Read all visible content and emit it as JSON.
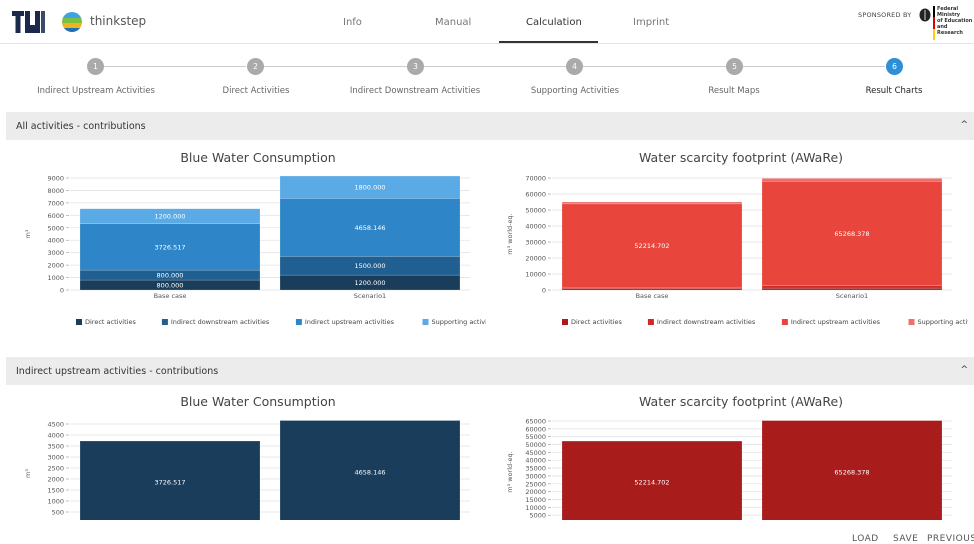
{
  "header": {
    "brand": "thinkstep",
    "tabs": [
      {
        "label": "Info"
      },
      {
        "label": "Manual"
      },
      {
        "label": "Calculation"
      },
      {
        "label": "Imprint"
      }
    ],
    "sponsored_by": "SPONSORED BY",
    "ministry_line1": "Federal Ministry",
    "ministry_line2": "of Education",
    "ministry_line3": "and Research"
  },
  "stepper": {
    "steps": [
      {
        "number": "1",
        "label": "Indirect Upstream Activities"
      },
      {
        "number": "2",
        "label": "Direct Activities"
      },
      {
        "number": "3",
        "label": "Indirect Downstream Activities"
      },
      {
        "number": "4",
        "label": "Supporting Activities"
      },
      {
        "number": "5",
        "label": "Result Maps"
      },
      {
        "number": "6",
        "label": "Result Charts"
      }
    ],
    "active_index": 5
  },
  "sections": [
    {
      "title": "All activities - contributions"
    },
    {
      "title": "Indirect upstream activities - contributions"
    }
  ],
  "colors": {
    "blue_direct": "#1a3d5c",
    "blue_downstream": "#1f5f91",
    "blue_upstream": "#2e86c8",
    "blue_supporting": "#5aaae6",
    "red_direct": "#a81c1c",
    "red_downstream": "#cf2a2a",
    "red_upstream": "#e8453c",
    "red_supporting": "#ef6f6f",
    "accent": "#2e8fd9"
  },
  "chart_data": [
    {
      "type": "bar",
      "stacked": true,
      "title": "Blue Water Consumption",
      "ylabel": "m³",
      "categories": [
        "Base case",
        "Scenario1"
      ],
      "ylim": [
        0,
        9000
      ],
      "yticks": [
        "9000",
        "8000",
        "7000",
        "6000",
        "5000",
        "4000",
        "3000",
        "2000",
        "1000",
        "0"
      ],
      "series": [
        {
          "name": "Direct activities",
          "values": [
            800,
            1200
          ],
          "labels": [
            "800.000",
            "1200.000"
          ]
        },
        {
          "name": "Indirect downstream activities",
          "values": [
            800,
            1500
          ],
          "labels": [
            "800.000",
            "1500.000"
          ]
        },
        {
          "name": "Indirect upstream activities",
          "values": [
            3726.517,
            4658.146
          ],
          "labels": [
            "3726.517",
            "4658.146"
          ]
        },
        {
          "name": "Supporting activities",
          "values": [
            1200,
            1800
          ],
          "labels": [
            "1200.000",
            "1800.000"
          ]
        }
      ],
      "legend": "bottom"
    },
    {
      "type": "bar",
      "stacked": true,
      "title": "Water scarcity footprint (AWaRe)",
      "ylabel": "m³ world-eq.",
      "categories": [
        "Base case",
        "Scenario1"
      ],
      "ylim": [
        0,
        70000
      ],
      "yticks": [
        "70000",
        "60000",
        "50000",
        "40000",
        "30000",
        "20000",
        "10000",
        "0"
      ],
      "series": [
        {
          "name": "Direct activities",
          "values": [
            800,
            1200
          ],
          "labels": [
            "",
            ""
          ]
        },
        {
          "name": "Indirect downstream activities",
          "values": [
            800,
            1500
          ],
          "labels": [
            "",
            ""
          ]
        },
        {
          "name": "Indirect upstream activities",
          "values": [
            52214.702,
            65268.378
          ],
          "labels": [
            "52214.702",
            "65268.378"
          ]
        },
        {
          "name": "Supporting activities",
          "values": [
            1200,
            1800
          ],
          "labels": [
            "",
            ""
          ]
        }
      ],
      "legend": "bottom"
    },
    {
      "type": "bar",
      "title": "Blue Water Consumption",
      "ylabel": "m³",
      "categories": [
        "Base case",
        "Scenario1"
      ],
      "ylim": [
        0,
        4500
      ],
      "yticks": [
        "4500",
        "4000",
        "3500",
        "3000",
        "2500",
        "2000",
        "1500",
        "1000",
        "500"
      ],
      "series": [
        {
          "name": "",
          "values": [
            3726.517,
            4658.146
          ],
          "labels": [
            "3726.517",
            "4658.146"
          ]
        }
      ]
    },
    {
      "type": "bar",
      "title": "Water scarcity footprint (AWaRe)",
      "ylabel": "m³ world-eq.",
      "categories": [
        "Base case",
        "Scenario1"
      ],
      "ylim": [
        0,
        65000
      ],
      "yticks": [
        "65000",
        "60000",
        "55000",
        "50000",
        "45000",
        "40000",
        "35000",
        "30000",
        "25000",
        "20000",
        "15000",
        "10000",
        "5000"
      ],
      "series": [
        {
          "name": "",
          "values": [
            52214.702,
            65268.378
          ],
          "labels": [
            "52214.702",
            "65268.378"
          ]
        }
      ]
    }
  ],
  "actions": {
    "load": "LOAD",
    "save": "SAVE",
    "previous": "PREVIOUS"
  }
}
